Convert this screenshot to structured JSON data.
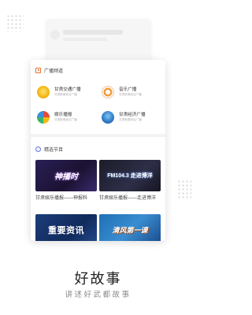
{
  "radio_section": {
    "title": "广播频道",
    "channels": [
      {
        "name": "甘肃交通广播",
        "sub": "甘肃新闻综合广播",
        "logo": "gansu-traffic-logo"
      },
      {
        "name": "音乐广播",
        "sub": "甘肃新闻综合广播",
        "logo": "music-radio-logo"
      },
      {
        "name": "娱乐播报",
        "sub": "甘肃新闻综合广播",
        "logo": "entertainment-logo"
      },
      {
        "name": "甘肃经济广播",
        "sub": "甘肃新闻综合广播",
        "logo": "gansu-economy-logo"
      }
    ]
  },
  "featured_section": {
    "title": "精选节目",
    "items": [
      {
        "thumb_text": "神播时",
        "caption": "甘肃娱乐播报——神报料"
      },
      {
        "thumb_text": "FM104.3 走进博洋",
        "caption": "甘肃娱乐播报——走进博洋"
      },
      {
        "thumb_text": "重要资讯",
        "caption": ""
      },
      {
        "thumb_text": "清风第一课",
        "caption": ""
      }
    ]
  },
  "tagline": {
    "title": "好故事",
    "subtitle": "讲述好武都故事"
  },
  "colors": {
    "accent": "#e8702a",
    "featured_icon": "#6a78d8"
  }
}
